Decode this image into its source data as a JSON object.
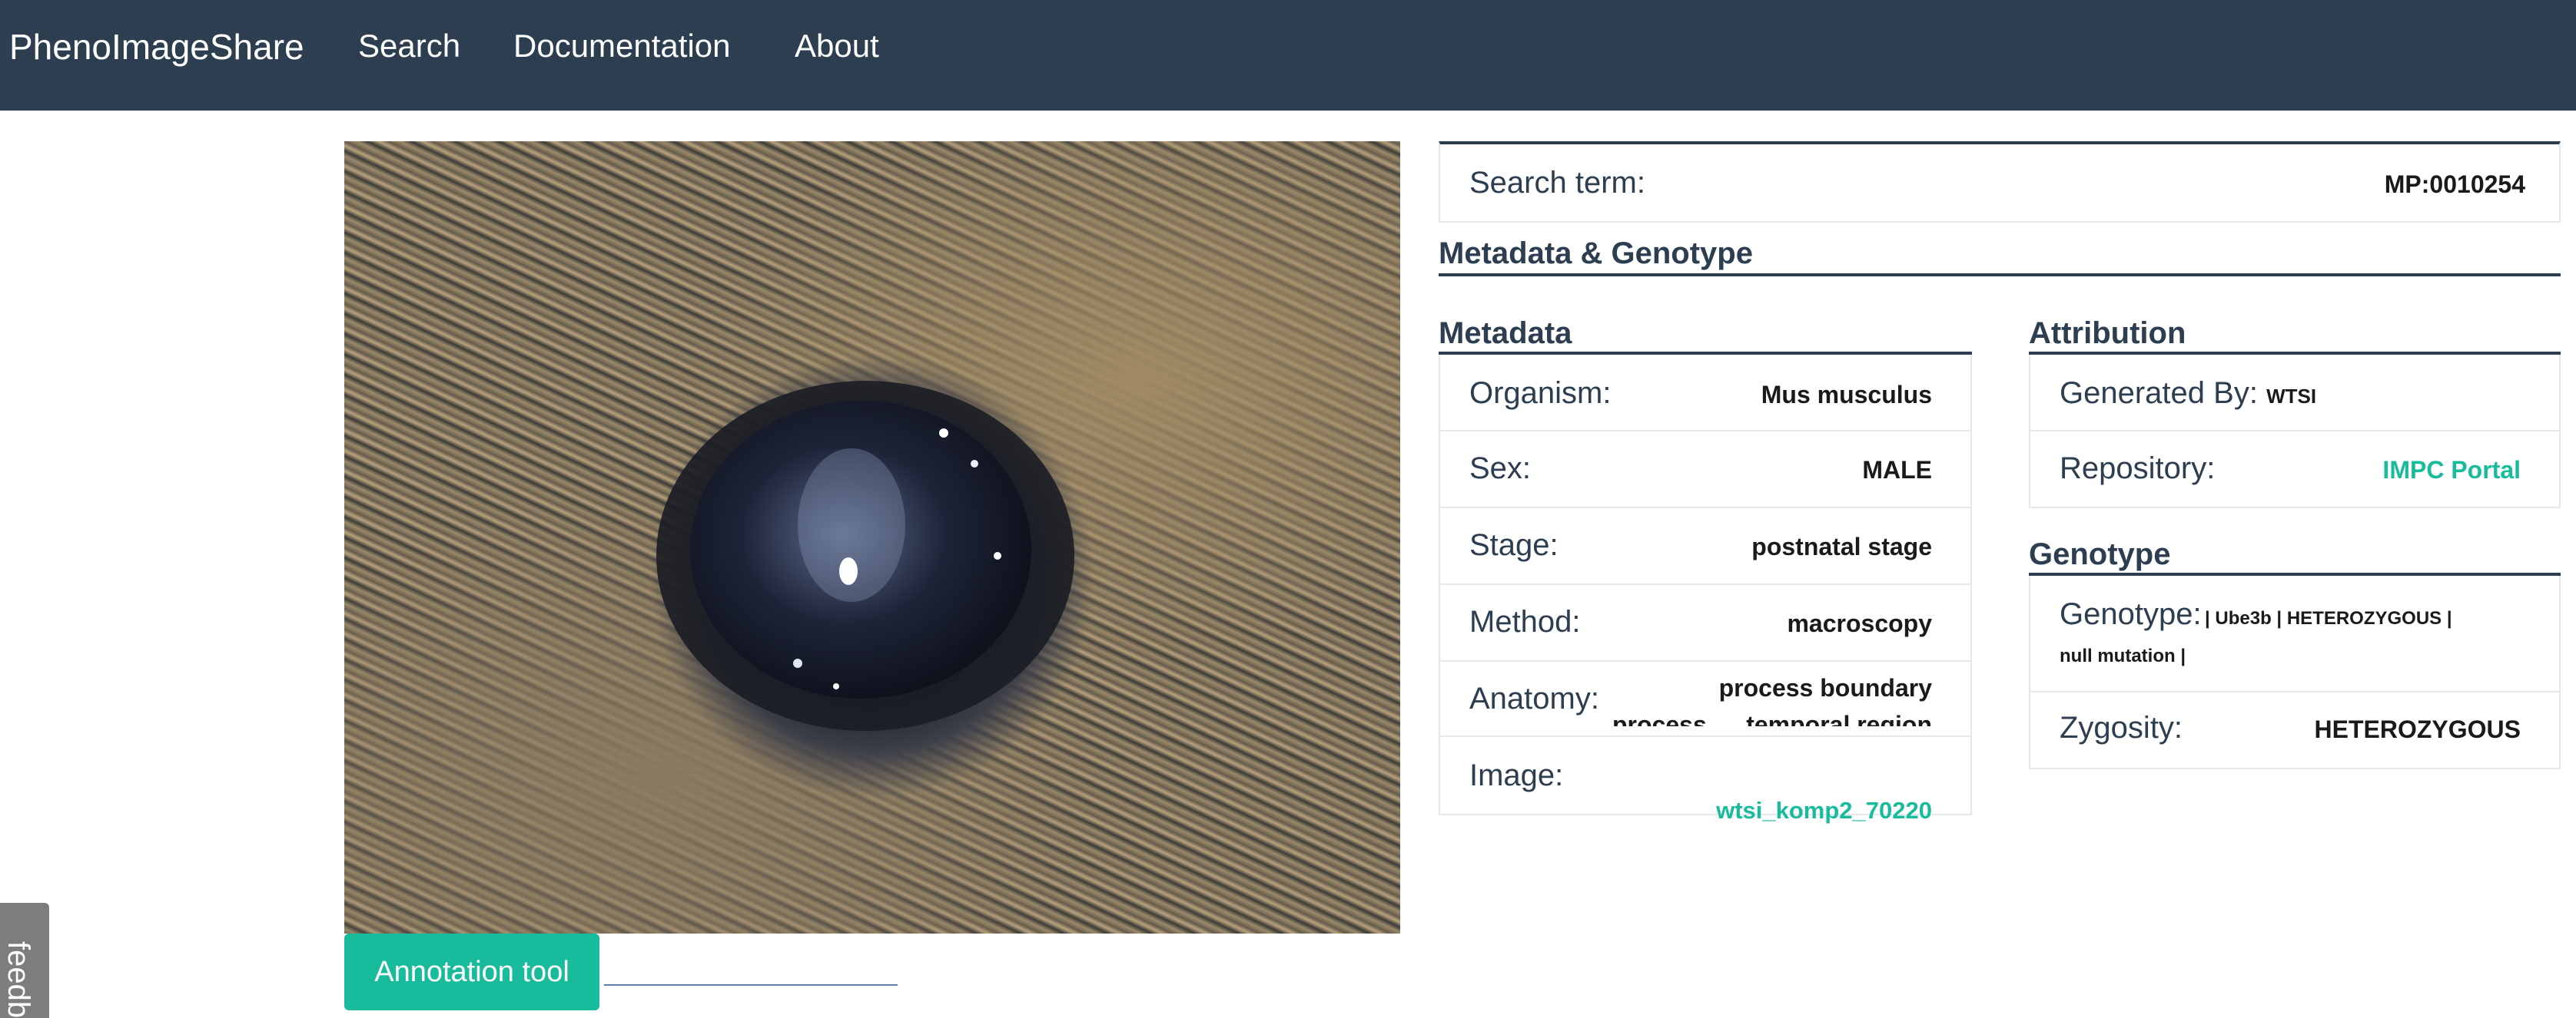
{
  "navbar": {
    "brand": "PhenoImageShare",
    "links": [
      "Search",
      "Documentation",
      "About"
    ]
  },
  "image": {
    "alt": "mouse eye macroscopy image"
  },
  "annotation_button": "Annotation tool",
  "feedback_tab": "feedback",
  "search_term": {
    "label": "Search term:",
    "value": "MP:0010254"
  },
  "metadata_genotype_heading": "Metadata & Genotype",
  "metadata": {
    "heading": "Metadata",
    "organism": {
      "label": "Organism:",
      "value": "Mus musculus"
    },
    "sex": {
      "label": "Sex:",
      "value": "MALE"
    },
    "stage": {
      "label": "Stage:",
      "value": "postnatal stage"
    },
    "method": {
      "label": "Method:",
      "value": "macroscopy"
    },
    "anatomy": {
      "label": "Anatomy:",
      "value": "process boundary",
      "value2": "process",
      "value3": "temporal region"
    },
    "image": {
      "label": "Image:",
      "value": "wtsi_komp2_70220"
    }
  },
  "attribution": {
    "heading": "Attribution",
    "generated_by": {
      "label": "Generated By:",
      "value": "WTSI"
    },
    "repository": {
      "label": "Repository:",
      "value": "IMPC Portal"
    }
  },
  "genotype": {
    "heading": "Genotype",
    "genotype": {
      "label": "Genotype:",
      "value_line1": "| Ube3b | HETEROZYGOUS |",
      "value_line2": "null mutation |"
    },
    "zygosity": {
      "label": "Zygosity:",
      "value": "HETEROZYGOUS"
    }
  },
  "colors": {
    "navbar": "#2c3e50",
    "accent": "#18bc9c",
    "text": "#2c3e50"
  }
}
